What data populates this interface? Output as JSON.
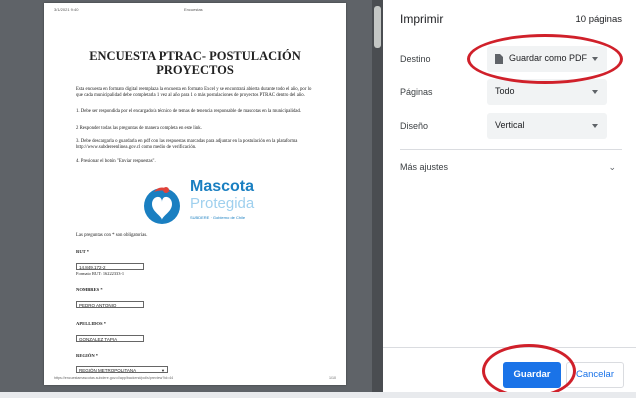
{
  "document": {
    "header_left": "3/1/2021 9:40",
    "header_center": "Encuestas",
    "title": "ENCUESTA PTRAC- POSTULACIÓN PROYECTOS",
    "intro": "Esta encuesta en formato digital reemplaza la encuesta en formato Excel y se encontrará abierta durante todo el año, por lo que cada municipalidad debe completarla 1 vez al año para 1 o más postulaciones de proyectos PTRAC dentro del año.",
    "step1": "1. Debe ser respondida por el encargado/a técnico de temas de tenencia responsable de mascotas en la municipalidad.",
    "step2": "2 Responder todas las preguntas de manera completa en este link.",
    "step3": "3. Debe descargarla o guardarla en pdf con las respuestas marcadas para adjuntar en la postulación en la plataforma http://www.subdereenlinea.gov.cl como medio de verificación.",
    "step4": "4. Presionar el botón \"Enviar respuestas\".",
    "logo_line1": "Mascota",
    "logo_line2": "Protegida",
    "logo_sub": "SUBDERE · Gobierno de Chile",
    "required_note": "Las preguntas con * son obligatorias.",
    "rut_label": "RUT *",
    "rut_value": "14.849.172-2",
    "rut_format": "Formato RUT: 16222333-1",
    "nombres_label": "NOMBRES *",
    "nombres_value": "PEDRO ANTONIO",
    "apellidos_label": "APELLIDOS *",
    "apellidos_value": "GONZALEZ TAPIA",
    "region_label": "REGIÓN *",
    "region_value": "REGIÓN METROPOLITANA",
    "footer_left": "https://encuestamascotas.subdere.gov.cl/app/backend/polls/preview?id=44",
    "footer_right": "1/10"
  },
  "print_panel": {
    "title": "Imprimir",
    "page_count": "10 páginas",
    "destino_label": "Destino",
    "destino_value": "Guardar como PDF",
    "paginas_label": "Páginas",
    "paginas_value": "Todo",
    "diseno_label": "Diseño",
    "diseno_value": "Vertical",
    "more_settings": "Más ajustes",
    "save_button": "Guardar",
    "cancel_button": "Cancelar"
  },
  "colors": {
    "accent": "#1a73e8",
    "highlight_ring": "#d0202a",
    "preview_bg": "#5f6368",
    "logo_blue": "#1a7fc1",
    "logo_red": "#e0433a"
  }
}
